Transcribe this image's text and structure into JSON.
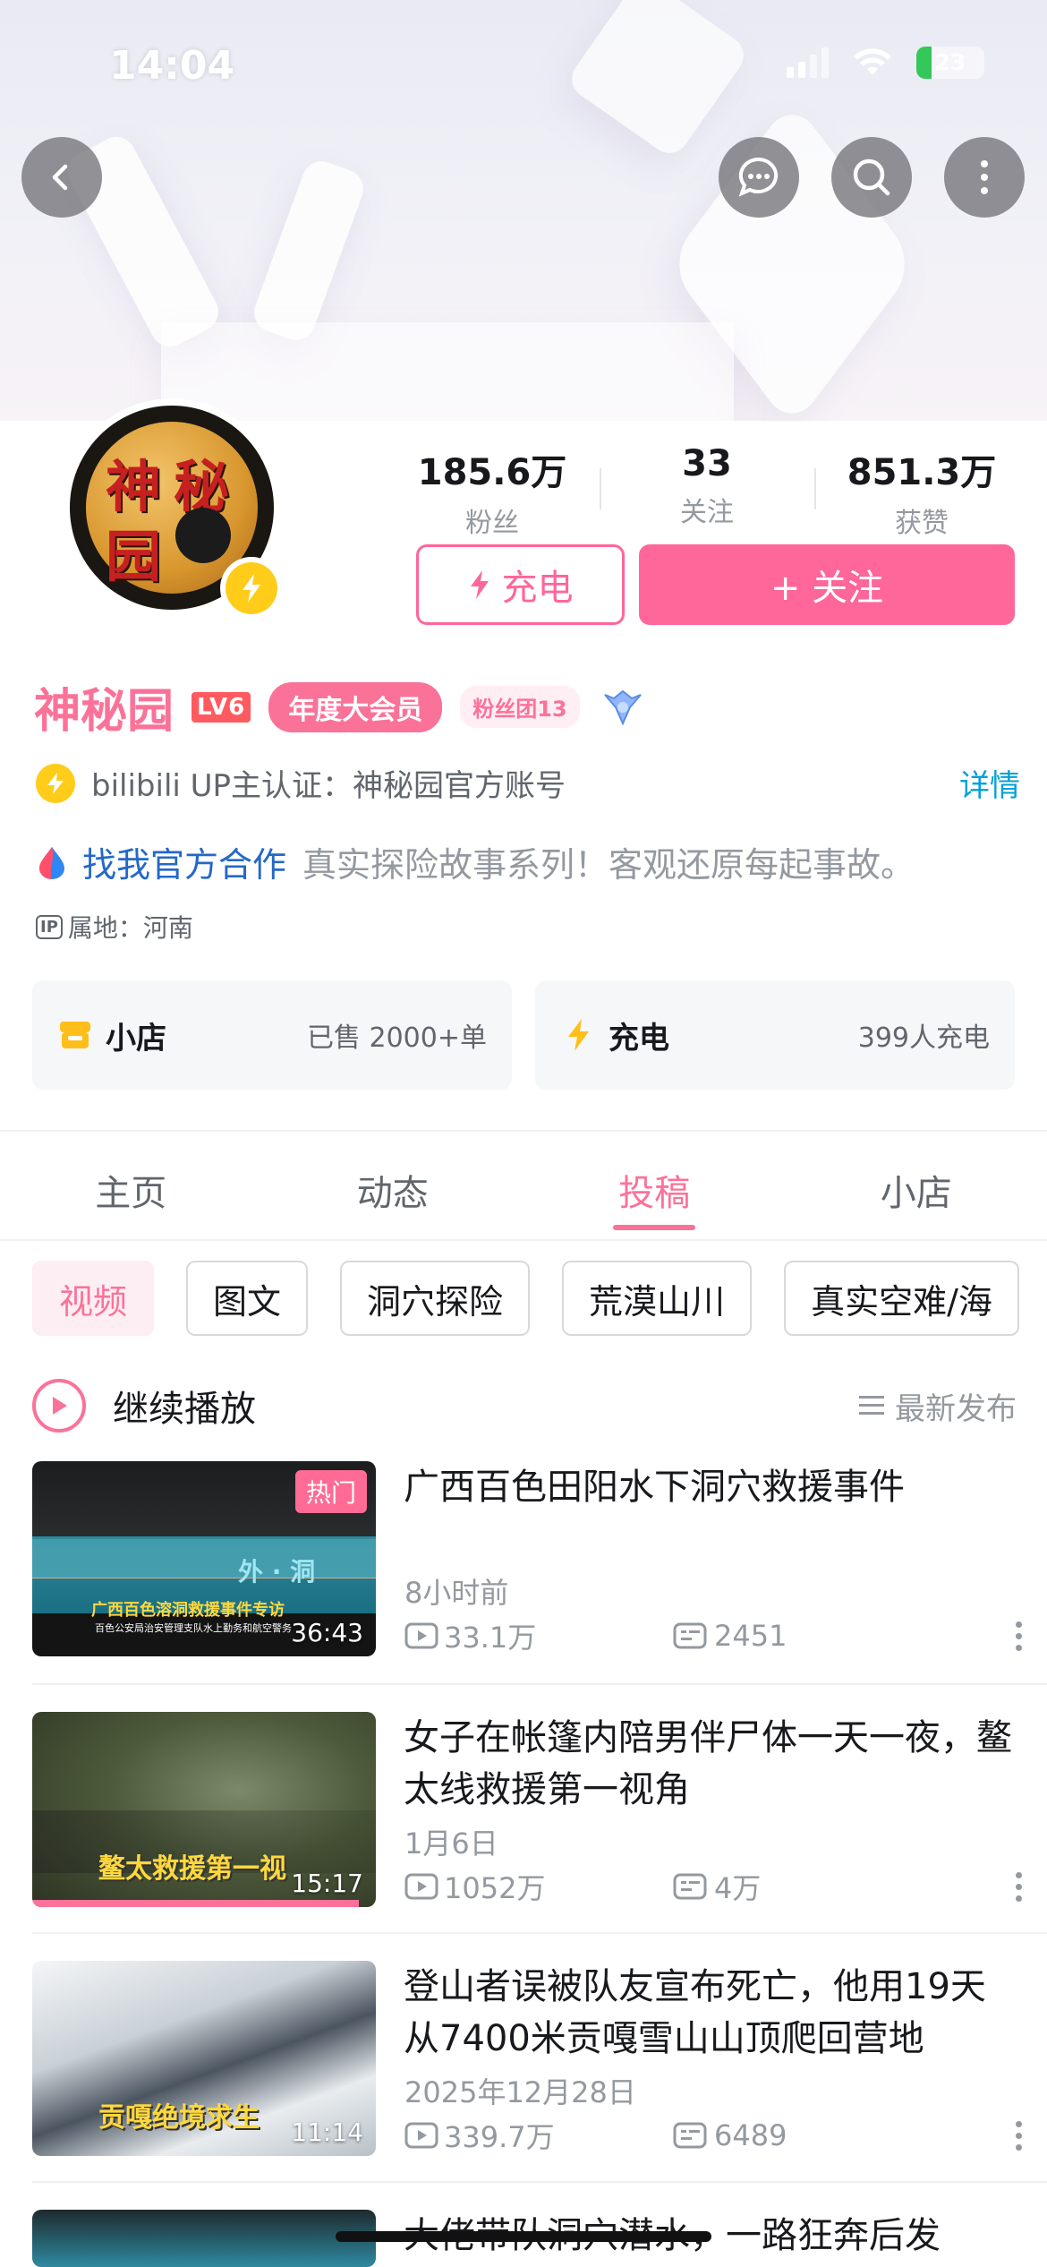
{
  "status": {
    "time": "14:04",
    "battery": "23"
  },
  "profile": {
    "avatar_text": [
      "神",
      "秘",
      "园"
    ],
    "followers_value": "185.6万",
    "followers_label": "粉丝",
    "following_value": "33",
    "following_label": "关注",
    "likes_value": "851.3万",
    "likes_label": "获赞",
    "charge_button": "充电",
    "follow_button": "+ 关注",
    "name": "神秘园",
    "level": "LV6",
    "vip_badge": "年度大会员",
    "fans_badge": "粉丝团13",
    "certification": "bilibili UP主认证：神秘园官方账号",
    "detail_link": "详情",
    "coop_link": "找我官方合作",
    "signature": "真实探险故事系列！客观还原每起事故。",
    "ip_tag": "IP",
    "ip_location": "属地：河南"
  },
  "cards": {
    "shop_title": "小店",
    "shop_sub": "已售 2000+单",
    "charge_title": "充电",
    "charge_sub": "399人充电"
  },
  "tabs": [
    "主页",
    "动态",
    "投稿",
    "小店"
  ],
  "active_tab": "投稿",
  "chips": [
    "视频",
    "图文",
    "洞穴探险",
    "荒漠山川",
    "真实空难/海"
  ],
  "continue_label": "继续播放",
  "sort_label": "最新发布",
  "videos": [
    {
      "title": "广西百色田阳水下洞穴救援事件",
      "date": "8小时前",
      "views": "33.1万",
      "danmaku": "2451",
      "duration": "36:43",
      "hot": "热门",
      "caption": "广西百色溶洞救援事件专访",
      "caption_sub": "百色公安局治安管理支队水上勤务和航空警务",
      "overlay": "外 · 洞",
      "progress": 0
    },
    {
      "title": "女子在帐篷内陪男伴尸体一天一夜，鳌太线救援第一视角",
      "date": "1月6日",
      "views": "1052万",
      "danmaku": "4万",
      "duration": "15:17",
      "caption": "鳌太救援第一视",
      "progress": 0.95
    },
    {
      "title": "登山者误被队友宣布死亡，他用19天从7400米贡嘎雪山山顶爬回营地",
      "date": "2025年12月28日",
      "views": "339.7万",
      "danmaku": "6489",
      "duration": "11:14",
      "caption": "贡嘎绝境求生",
      "progress": 0
    },
    {
      "title": "大佬带队洞穴潜水，一路狂奔后发"
    }
  ],
  "colors": {
    "accent": "#fb7299",
    "follow_bg": "#ff6699",
    "link": "#00a1d6",
    "coop": "#2468c8"
  }
}
